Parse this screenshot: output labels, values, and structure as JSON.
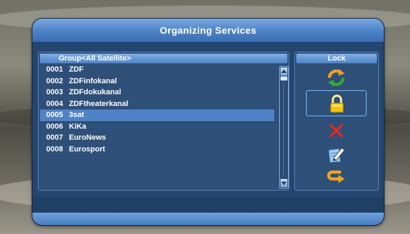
{
  "dialog": {
    "title": "Organizing Services"
  },
  "list": {
    "header": "Group<All Satellite>",
    "selected_index": 4,
    "channels": [
      {
        "number": "0001",
        "name": "ZDF"
      },
      {
        "number": "0002",
        "name": "ZDFinfokanal"
      },
      {
        "number": "0003",
        "name": "ZDFdokukanal"
      },
      {
        "number": "0004",
        "name": "ZDFtheaterkanal"
      },
      {
        "number": "0005",
        "name": "3sat"
      },
      {
        "number": "0006",
        "name": "KiKa"
      },
      {
        "number": "0007",
        "name": "EuroNews"
      },
      {
        "number": "0008",
        "name": "Eurosport"
      }
    ]
  },
  "side_panel": {
    "header": "Lock",
    "focused_action": "lock",
    "actions": [
      {
        "id": "move",
        "icon": "move-arrows-icon"
      },
      {
        "id": "lock",
        "icon": "padlock-icon"
      },
      {
        "id": "delete",
        "icon": "red-x-icon"
      },
      {
        "id": "rename",
        "icon": "pencil-edit-icon"
      },
      {
        "id": "exit",
        "icon": "return-arrow-icon"
      }
    ]
  },
  "colors": {
    "accent": "#4f82c6",
    "panel": "#2d4f78",
    "text": "#ffffff",
    "delete": "#e02a1f",
    "lock": "#f5c400"
  }
}
